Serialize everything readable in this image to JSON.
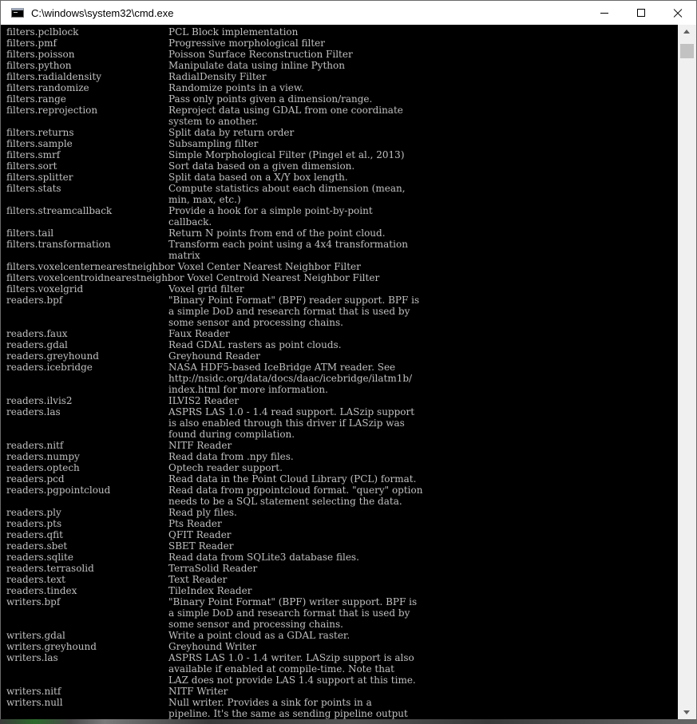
{
  "window": {
    "title": "C:\\windows\\system32\\cmd.exe",
    "icons": {
      "app": "console-icon",
      "minimize": "minimize-icon",
      "maximize": "maximize-icon",
      "close": "close-icon"
    }
  },
  "colors": {
    "console_bg": "#000000",
    "console_text": "#c0c0c0",
    "titlebar_bg": "#ffffff"
  },
  "lines": [
    {
      "name": "filters.pclblock",
      "desc": "PCL Block implementation"
    },
    {
      "name": "filters.pmf",
      "desc": "Progressive morphological filter"
    },
    {
      "name": "filters.poisson",
      "desc": "Poisson Surface Reconstruction Filter"
    },
    {
      "name": "filters.python",
      "desc": "Manipulate data using inline Python"
    },
    {
      "name": "filters.radialdensity",
      "desc": "RadialDensity Filter"
    },
    {
      "name": "filters.randomize",
      "desc": "Randomize points in a view."
    },
    {
      "name": "filters.range",
      "desc": "Pass only points given a dimension/range."
    },
    {
      "name": "filters.reprojection",
      "desc": "Reproject data using GDAL from one coordinate"
    },
    {
      "name": "",
      "desc": "system to another."
    },
    {
      "name": "filters.returns",
      "desc": "Split data by return order"
    },
    {
      "name": "filters.sample",
      "desc": "Subsampling filter"
    },
    {
      "name": "filters.smrf",
      "desc": "Simple Morphological Filter (Pingel et al., 2013)"
    },
    {
      "name": "filters.sort",
      "desc": "Sort data based on a given dimension."
    },
    {
      "name": "filters.splitter",
      "desc": "Split data based on a X/Y box length."
    },
    {
      "name": "filters.stats",
      "desc": "Compute statistics about each dimension (mean,"
    },
    {
      "name": "",
      "desc": "min, max, etc.)"
    },
    {
      "name": "filters.streamcallback",
      "desc": "Provide a hook for a simple point-by-point"
    },
    {
      "name": "",
      "desc": "callback."
    },
    {
      "name": "filters.tail",
      "desc": "Return N points from end of the point cloud."
    },
    {
      "name": "filters.transformation",
      "desc": "Transform each point using a 4x4 transformation"
    },
    {
      "name": "",
      "desc": "matrix"
    },
    {
      "name": "filters.voxelcenternearestneighbor Voxel Center Nearest Neighbor Filter",
      "desc": ""
    },
    {
      "name": "filters.voxelcentroidnearestneighbor Voxel Centroid Nearest Neighbor Filter",
      "desc": ""
    },
    {
      "name": "filters.voxelgrid",
      "desc": "Voxel grid filter"
    },
    {
      "name": "readers.bpf",
      "desc": "\"Binary Point Format\" (BPF) reader support. BPF is"
    },
    {
      "name": "",
      "desc": "a simple DoD and research format that is used by"
    },
    {
      "name": "",
      "desc": "some sensor and processing chains."
    },
    {
      "name": "readers.faux",
      "desc": "Faux Reader"
    },
    {
      "name": "readers.gdal",
      "desc": "Read GDAL rasters as point clouds."
    },
    {
      "name": "readers.greyhound",
      "desc": "Greyhound Reader"
    },
    {
      "name": "readers.icebridge",
      "desc": "NASA HDF5-based IceBridge ATM reader. See"
    },
    {
      "name": "",
      "desc": "http://nsidc.org/data/docs/daac/icebridge/ilatm1b/"
    },
    {
      "name": "",
      "desc": "index.html for more information."
    },
    {
      "name": "readers.ilvis2",
      "desc": "ILVIS2 Reader"
    },
    {
      "name": "readers.las",
      "desc": "ASPRS LAS 1.0 - 1.4 read support. LASzip support"
    },
    {
      "name": "",
      "desc": "is also enabled through this driver if LASzip was"
    },
    {
      "name": "",
      "desc": "found during compilation."
    },
    {
      "name": "readers.nitf",
      "desc": "NITF Reader"
    },
    {
      "name": "readers.numpy",
      "desc": "Read data from .npy files."
    },
    {
      "name": "readers.optech",
      "desc": "Optech reader support."
    },
    {
      "name": "readers.pcd",
      "desc": "Read data in the Point Cloud Library (PCL) format."
    },
    {
      "name": "readers.pgpointcloud",
      "desc": "Read data from pgpointcloud format. \"query\" option"
    },
    {
      "name": "",
      "desc": "needs to be a SQL statement selecting the data."
    },
    {
      "name": "readers.ply",
      "desc": "Read ply files."
    },
    {
      "name": "readers.pts",
      "desc": "Pts Reader"
    },
    {
      "name": "readers.qfit",
      "desc": "QFIT Reader"
    },
    {
      "name": "readers.sbet",
      "desc": "SBET Reader"
    },
    {
      "name": "readers.sqlite",
      "desc": "Read data from SQLite3 database files."
    },
    {
      "name": "readers.terrasolid",
      "desc": "TerraSolid Reader"
    },
    {
      "name": "readers.text",
      "desc": "Text Reader"
    },
    {
      "name": "readers.tindex",
      "desc": "TileIndex Reader"
    },
    {
      "name": "writers.bpf",
      "desc": "\"Binary Point Format\" (BPF) writer support. BPF is"
    },
    {
      "name": "",
      "desc": "a simple DoD and research format that is used by"
    },
    {
      "name": "",
      "desc": "some sensor and processing chains."
    },
    {
      "name": "writers.gdal",
      "desc": "Write a point cloud as a GDAL raster."
    },
    {
      "name": "writers.greyhound",
      "desc": "Greyhound Writer"
    },
    {
      "name": "writers.las",
      "desc": "ASPRS LAS 1.0 - 1.4 writer. LASzip support is also"
    },
    {
      "name": "",
      "desc": "available if enabled at compile-time. Note that"
    },
    {
      "name": "",
      "desc": "LAZ does not provide LAS 1.4 support at this time."
    },
    {
      "name": "writers.nitf",
      "desc": "NITF Writer"
    },
    {
      "name": "writers.null",
      "desc": "Null writer. Provides a sink for points in a"
    },
    {
      "name": "",
      "desc": "pipeline. It's the same as sending pipeline output"
    }
  ]
}
